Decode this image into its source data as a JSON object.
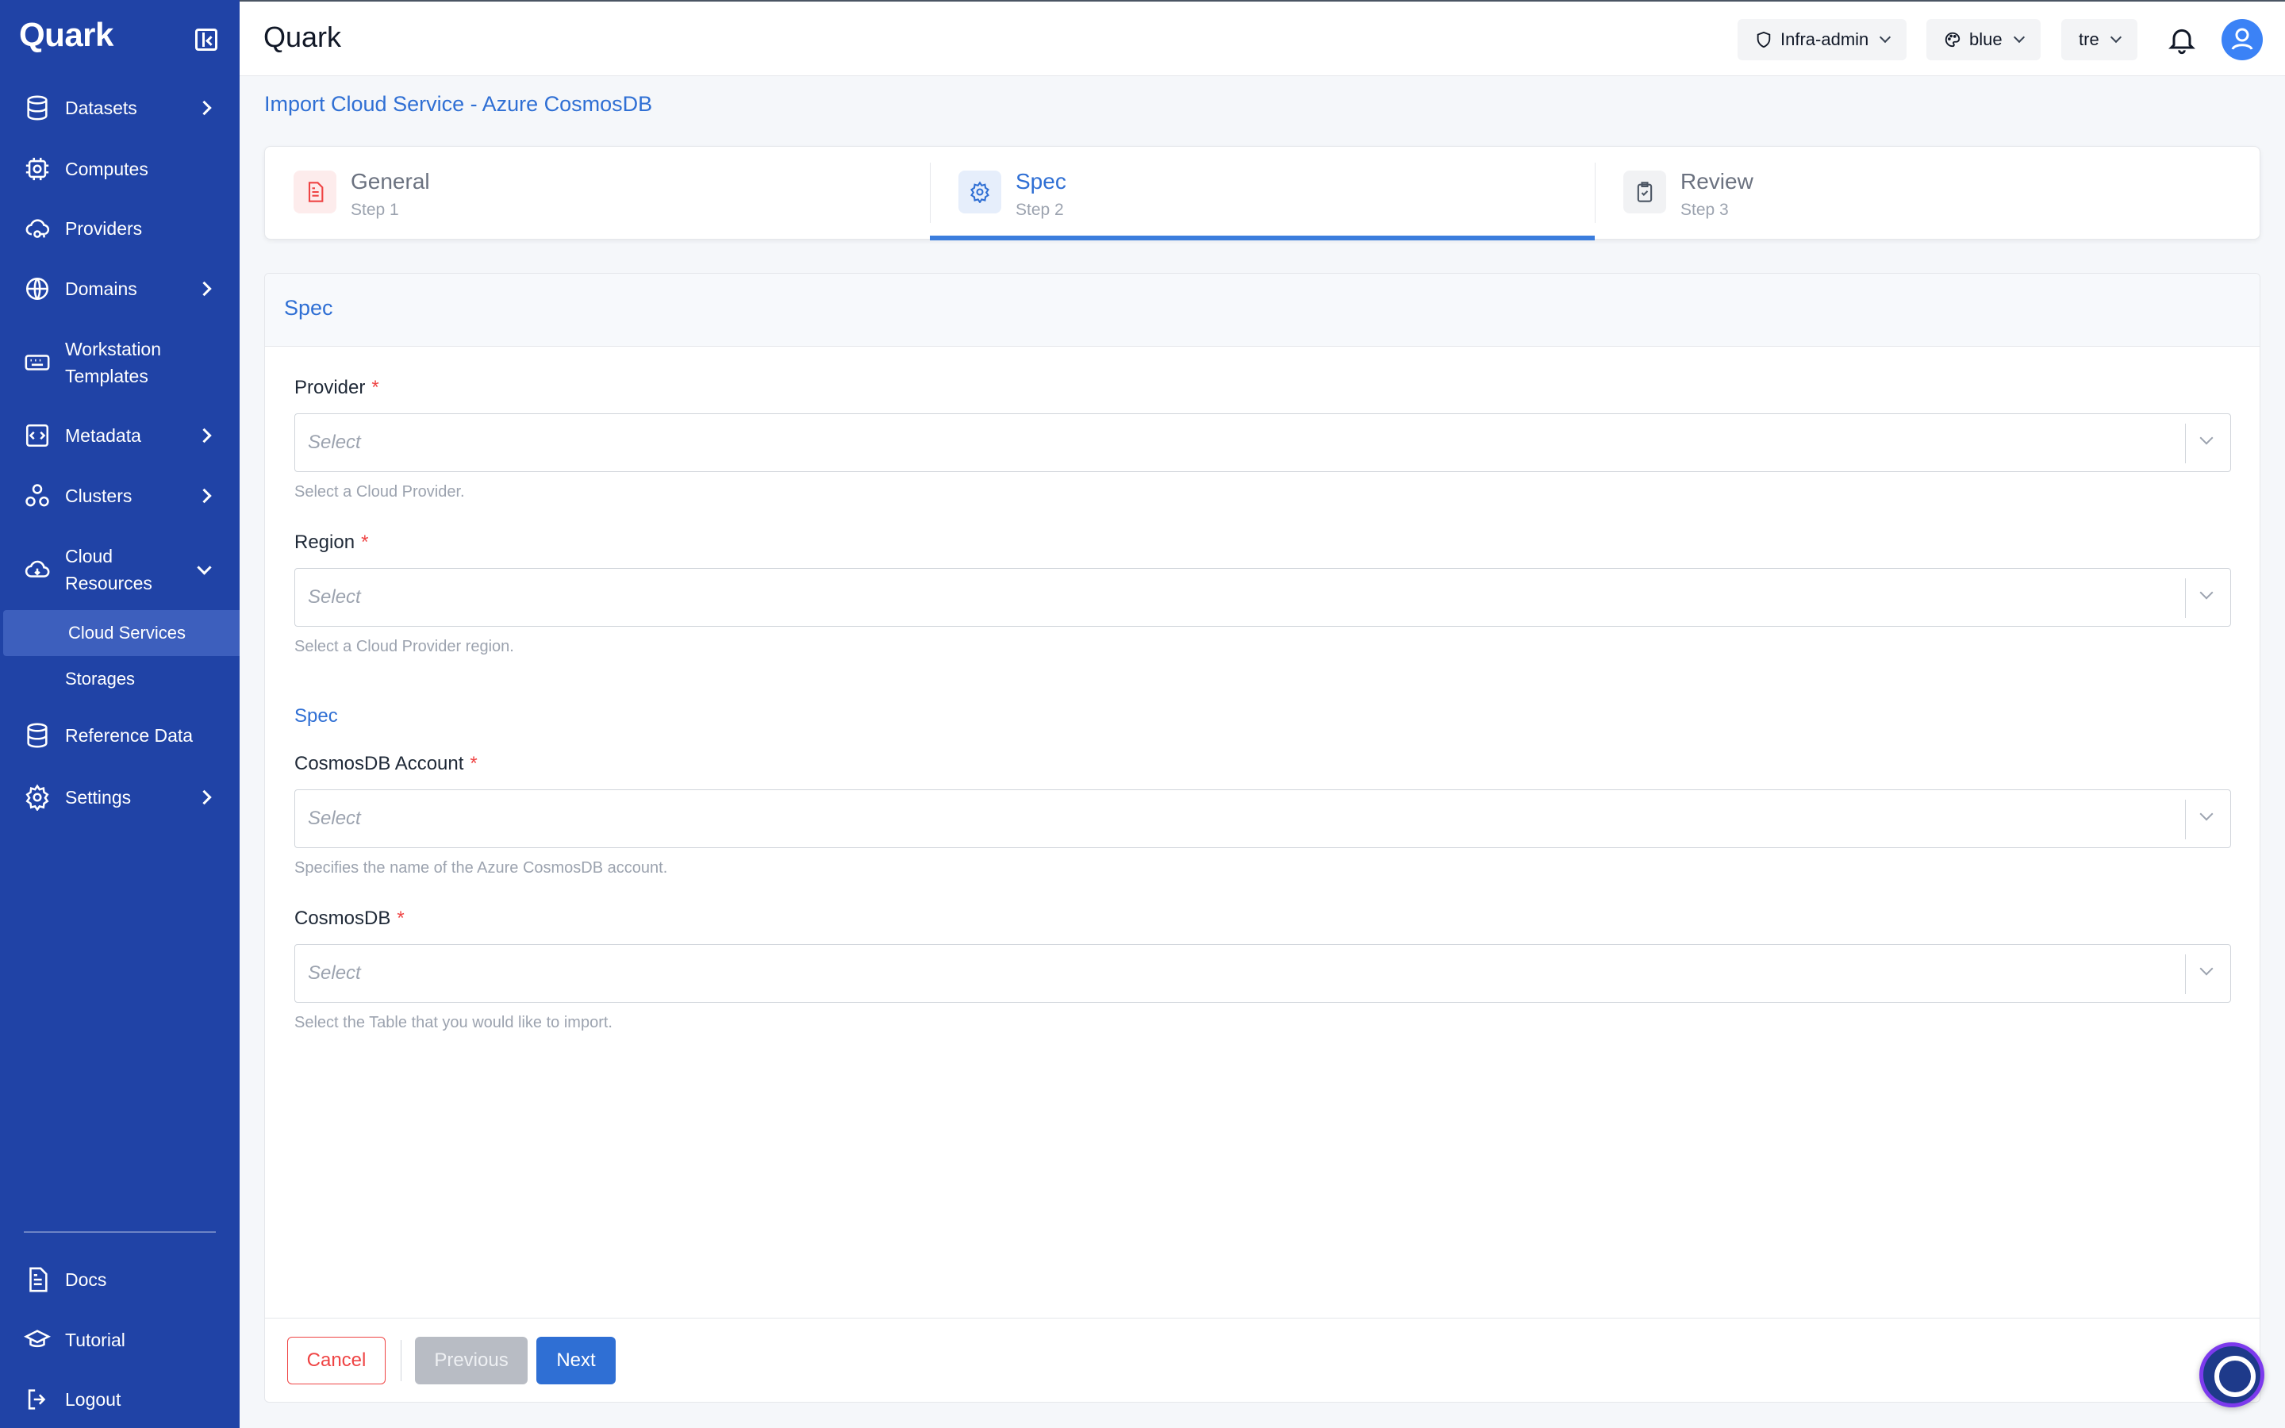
{
  "app": {
    "brand": "Quark",
    "title": "Quark"
  },
  "header": {
    "role": "Infra-admin",
    "theme": "blue",
    "workspace": "tre"
  },
  "sidebar": {
    "items": [
      {
        "label": "Datasets",
        "icon": "database-icon"
      },
      {
        "label": "Computes",
        "icon": "cpu-icon"
      },
      {
        "label": "Providers",
        "icon": "cloud-key-icon"
      },
      {
        "label": "Domains",
        "icon": "globe-icon"
      },
      {
        "label": "Workstation Templates",
        "icon": "keyboard-icon"
      },
      {
        "label": "Metadata",
        "icon": "code-icon"
      },
      {
        "label": "Clusters",
        "icon": "cluster-icon"
      },
      {
        "label": "Cloud Resources",
        "icon": "cloud-icon"
      },
      {
        "label": "Reference Data",
        "icon": "database-icon"
      },
      {
        "label": "Settings",
        "icon": "gear-icon"
      }
    ],
    "sub_items": {
      "cloud_services": "Cloud Services",
      "storages": "Storages"
    },
    "bottom": {
      "docs": "Docs",
      "tutorial": "Tutorial",
      "logout": "Logout"
    }
  },
  "page": {
    "title": "Import Cloud Service - Azure CosmosDB"
  },
  "stepper": {
    "steps": [
      {
        "title": "General",
        "sub": "Step 1"
      },
      {
        "title": "Spec",
        "sub": "Step 2"
      },
      {
        "title": "Review",
        "sub": "Step 3"
      }
    ],
    "active": 1
  },
  "form": {
    "heading": "Spec",
    "provider": {
      "label": "Provider",
      "placeholder": "Select",
      "hint": "Select a Cloud Provider."
    },
    "region": {
      "label": "Region",
      "placeholder": "Select",
      "hint": "Select a Cloud Provider region."
    },
    "section": "Spec",
    "account": {
      "label": "CosmosDB Account",
      "placeholder": "Select",
      "hint": "Specifies the name of the Azure CosmosDB account."
    },
    "cosmosdb": {
      "label": "CosmosDB",
      "placeholder": "Select",
      "hint": "Select the Table that you would like to import."
    },
    "required_mark": "*"
  },
  "actions": {
    "cancel": "Cancel",
    "previous": "Previous",
    "next": "Next"
  },
  "colors": {
    "sidebar": "#2043a6",
    "accent": "#2f6fd4",
    "danger": "#ef4444"
  }
}
